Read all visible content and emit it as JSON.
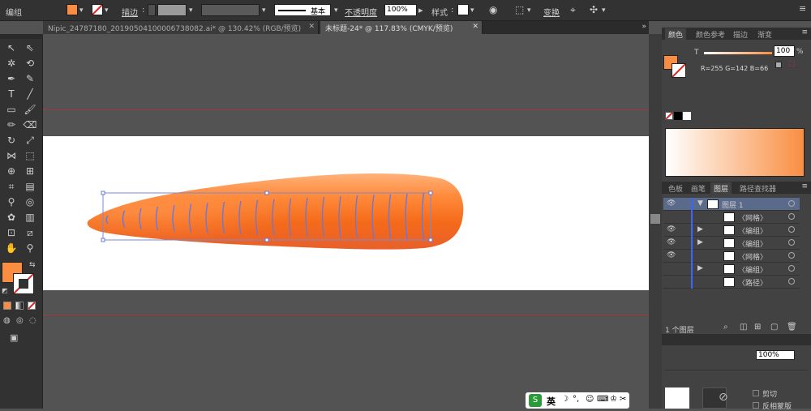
{
  "colors": {
    "accent": "#F98E42",
    "control_bg": "#323232",
    "canvas": "#535353",
    "artboard": "#FFFFFF",
    "guide": "#A03A3A",
    "layer_color": "#3C64FF",
    "link": "#E09A4A"
  },
  "control": {
    "group_label": "编组",
    "stroke_label": "描边",
    "stroke_style": "基本",
    "opacity_label": "不透明度",
    "opacity_value": "100%",
    "style_label": "样式",
    "transform_label": "变换"
  },
  "tabs": [
    {
      "label": "Nipic_24787180_20190504100006738082.ai* @ 130.42% (RGB/预览)",
      "active": false
    },
    {
      "label": "未标题-24* @ 117.83% (CMYK/预览)",
      "active": true
    }
  ],
  "tools": [
    "selection-icon",
    "direct-selection-icon",
    "magic-wand-icon",
    "lasso-icon",
    "pen-icon",
    "curvature-icon",
    "type-icon",
    "line-icon",
    "rectangle-icon",
    "paintbrush-icon",
    "pencil-icon",
    "eraser-icon",
    "rotate-icon",
    "scale-icon",
    "width-icon",
    "free-transform-icon",
    "shape-builder-icon",
    "perspective-icon",
    "mesh-icon",
    "gradient-icon",
    "eyedropper-icon",
    "blend-icon",
    "symbol-sprayer-icon",
    "column-graph-icon",
    "artboard-icon",
    "slice-icon",
    "hand-icon",
    "zoom-icon"
  ],
  "color_panel": {
    "tabs": [
      "颜色",
      "颜色参考",
      "描边",
      "渐变"
    ],
    "active_tab": "颜色",
    "t_label": "T",
    "t_value": "100",
    "percent": "%",
    "rgb_text": "R=255 G=142 B=66"
  },
  "layers_panel": {
    "tabs": [
      "色板",
      "画笔",
      "图层",
      "路径查找器"
    ],
    "active_tab": "图层",
    "rows": [
      {
        "name": "图层 1",
        "visible": true,
        "expand": "▼",
        "selected": true
      },
      {
        "name": "〈网格〉",
        "visible": false,
        "expand": ""
      },
      {
        "name": "〈编组〉",
        "visible": true,
        "expand": "▶"
      },
      {
        "name": "〈编组〉",
        "visible": true,
        "expand": "▶"
      },
      {
        "name": "〈网格〉",
        "visible": true,
        "expand": ""
      },
      {
        "name": "〈编组〉",
        "visible": false,
        "expand": "▶"
      },
      {
        "name": "〈路径〉",
        "visible": false,
        "expand": ""
      }
    ],
    "footer": "1 个图层",
    "bottom_pct": "100%",
    "cut_label": "剪切",
    "invert_label": "反相蒙版"
  },
  "taskbar": {
    "ime": "英",
    "s_label": "S"
  }
}
